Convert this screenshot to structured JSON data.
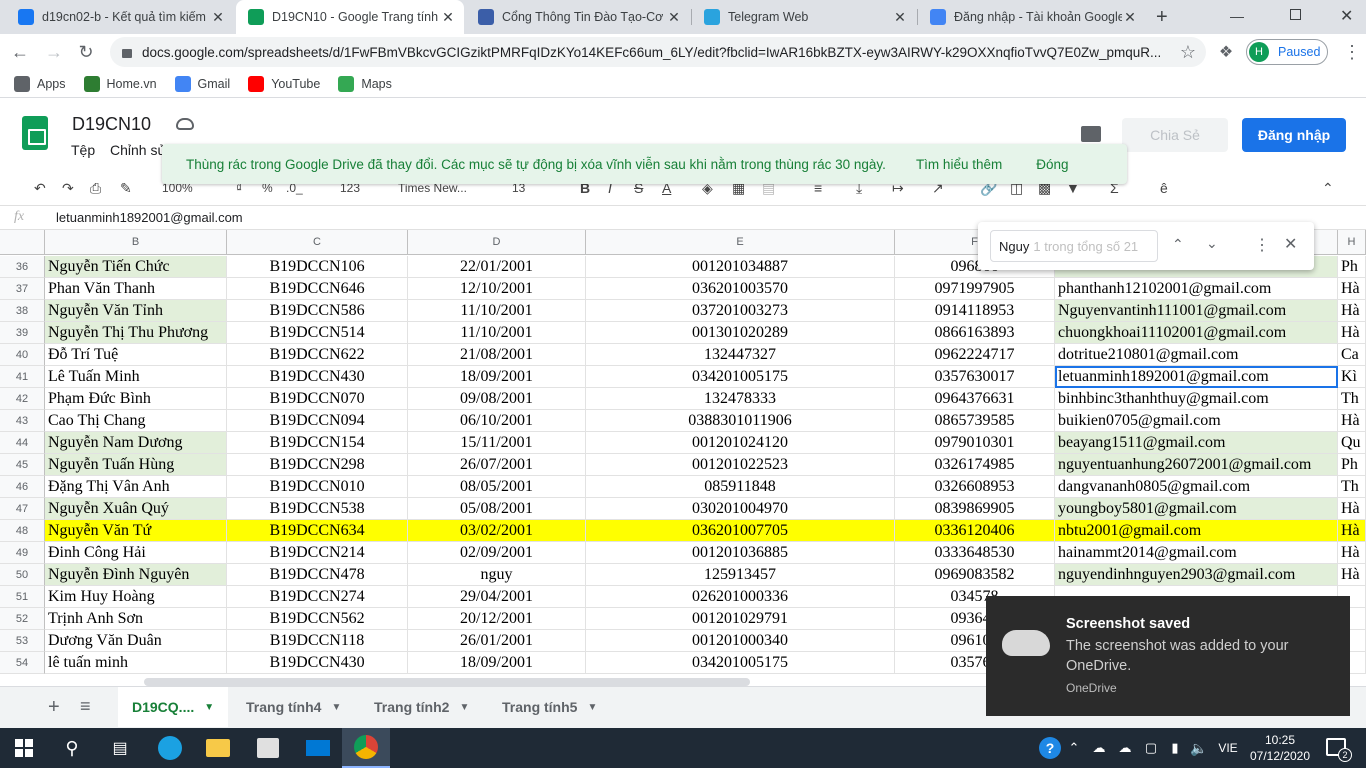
{
  "browser": {
    "tabs": [
      {
        "title": "d19cn02-b - Kết quả tìm kiếm",
        "icon": "facebook-icon",
        "color": "#1877f2"
      },
      {
        "title": "D19CN10 - Google Trang tính",
        "icon": "sheets-icon",
        "color": "#0f9d58"
      },
      {
        "title": "Cổng Thông Tin Đào Tạo-Cơ Sở",
        "icon": "portal-icon",
        "color": "#3b5ea8"
      },
      {
        "title": "Telegram Web",
        "icon": "telegram-icon",
        "color": "#2aa3de"
      },
      {
        "title": "Đăng nhập - Tài khoản Google",
        "icon": "google-icon",
        "color": "#4285f4"
      }
    ],
    "url": "docs.google.com/spreadsheets/d/1FwFBmVBkcvGCIGziktPMRFqIDzKYo14KEFc66um_6LY/edit?fbclid=IwAR16bkBZTX-eyw3AIRWY-k29OXXnqfioTvvQ7E0Zw_pmquR...",
    "profile_initial": "H",
    "profile_status": "Paused",
    "bookmarks": [
      {
        "label": "Apps",
        "icon": "apps-grid-icon"
      },
      {
        "label": "Home.vn",
        "icon": "home-vn-icon"
      },
      {
        "label": "Gmail",
        "icon": "google-icon"
      },
      {
        "label": "YouTube",
        "icon": "youtube-icon"
      },
      {
        "label": "Maps",
        "icon": "maps-icon"
      }
    ]
  },
  "sheets": {
    "doc_title": "D19CN10",
    "menu": [
      "Tệp",
      "Chỉnh sửa"
    ],
    "share_label": "Chia Sẻ",
    "login_label": "Đăng nhập",
    "toast": {
      "message": "Thùng rác trong Google Drive đã thay đổi. Các mục sẽ tự động bị xóa vĩnh viễn sau khi nằm trong thùng rác 30 ngày.",
      "learn_more": "Tìm hiểu thêm",
      "dismiss": "Đóng"
    },
    "toolbar": {
      "zoom": "100%",
      "percent": "%",
      "decimals": ".0_",
      "format_123": "123",
      "font": "Times New...",
      "font_size": "13"
    },
    "formula_bar": {
      "fx": "fx",
      "value": "letuanminh1892001@gmail.com"
    },
    "find": {
      "query": "Nguy",
      "count": "1 trong tổng số 21"
    },
    "columns": [
      "B",
      "C",
      "D",
      "E",
      "F",
      "G",
      "H"
    ],
    "rows": [
      {
        "num": "36",
        "name": "Nguyễn Tiến Chức",
        "id": "B19DCCN106",
        "dob": "22/01/2001",
        "cmnd": "001201034887",
        "phone": "096866",
        "email": "",
        "h": "Ph",
        "green": true,
        "hl": false
      },
      {
        "num": "37",
        "name": "Phan Văn Thanh",
        "id": "B19DCCN646",
        "dob": "12/10/2001",
        "cmnd": "036201003570",
        "phone": "0971997905",
        "email": "phanthanh12102001@gmail.com",
        "h": "Hà",
        "green": false,
        "hl": false
      },
      {
        "num": "38",
        "name": "Nguyễn Văn Tỉnh",
        "id": "B19DCCN586",
        "dob": "11/10/2001",
        "cmnd": "037201003273",
        "phone": "0914118953",
        "email": "Nguyenvantinh111001@gmail.com",
        "h": "Hà",
        "green": true,
        "hl": false
      },
      {
        "num": "39",
        "name": "Nguyễn Thị Thu Phương",
        "id": "B19DCCN514",
        "dob": "11/10/2001",
        "cmnd": "001301020289",
        "phone": "0866163893",
        "email": "chuongkhoai11102001@gmail.com",
        "h": "Hà",
        "green": true,
        "hl": false
      },
      {
        "num": "40",
        "name": "Đỗ Trí Tuệ",
        "id": "B19DCCN622",
        "dob": "21/08/2001",
        "cmnd": "132447327",
        "phone": "0962224717",
        "email": "dotritue210801@gmail.com",
        "h": "Ca",
        "green": false,
        "hl": false
      },
      {
        "num": "41",
        "name": "Lê Tuấn Minh",
        "id": "B19DCCN430",
        "dob": "18/09/2001",
        "cmnd": "034201005175",
        "phone": "0357630017",
        "email": "letuanminh1892001@gmail.com",
        "h": "Kì",
        "green": false,
        "hl": false
      },
      {
        "num": "42",
        "name": "Phạm Đức Bình",
        "id": "B19DCCN070",
        "dob": "09/08/2001",
        "cmnd": "132478333",
        "phone": "0964376631",
        "email": "binhbinc3thanhthuy@gmail.com",
        "h": "Th",
        "green": false,
        "hl": false
      },
      {
        "num": "43",
        "name": "Cao Thị Chang",
        "id": "B19DCCN094",
        "dob": "06/10/2001",
        "cmnd": "0388301011906",
        "phone": "0865739585",
        "email": "buikien0705@gmail.com",
        "h": "Hà",
        "green": false,
        "hl": false
      },
      {
        "num": "44",
        "name": "Nguyễn Nam Dương",
        "id": "B19DCCN154",
        "dob": "15/11/2001",
        "cmnd": "001201024120",
        "phone": "0979010301",
        "email": "beayang1511@gmail.com",
        "h": "Qu",
        "green": true,
        "hl": false
      },
      {
        "num": "45",
        "name": "Nguyễn Tuấn Hùng",
        "id": "B19DCCN298",
        "dob": "26/07/2001",
        "cmnd": "001201022523",
        "phone": "0326174985",
        "email": "nguyentuanhung26072001@gmail.com",
        "h": "Ph",
        "green": true,
        "hl": false
      },
      {
        "num": "46",
        "name": "Đặng Thị Vân Anh",
        "id": "B19DCCN010",
        "dob": "08/05/2001",
        "cmnd": "085911848",
        "phone": "0326608953",
        "email": "dangvananh0805@gmail.com",
        "h": "Th",
        "green": false,
        "hl": false
      },
      {
        "num": "47",
        "name": "Nguyễn Xuân Quý",
        "id": "B19DCCN538",
        "dob": "05/08/2001",
        "cmnd": "030201004970",
        "phone": "0839869905",
        "email": "youngboy5801@gmail.com",
        "h": "Hà",
        "green": true,
        "hl": false
      },
      {
        "num": "48",
        "name": "Nguyễn Văn Tứ",
        "id": "B19DCCN634",
        "dob": "03/02/2001",
        "cmnd": "036201007705",
        "phone": "0336120406",
        "email": "nbtu2001@gmail.com",
        "h": "Hà",
        "green": false,
        "hl": true
      },
      {
        "num": "49",
        "name": "Đinh Công Hải",
        "id": "B19DCCN214",
        "dob": "02/09/2001",
        "cmnd": "001201036885",
        "phone": "0333648530",
        "email": "hainammt2014@gmail.com",
        "h": "Hà",
        "green": false,
        "hl": false
      },
      {
        "num": "50",
        "name": "Nguyễn Đình Nguyên",
        "id": "B19DCCN478",
        "dob": "nguy",
        "cmnd": "125913457",
        "phone": "0969083582",
        "email": "nguyendinhnguyen2903@gmail.com",
        "h": "Hà",
        "green": true,
        "hl": false
      },
      {
        "num": "51",
        "name": "Kim Huy Hoàng",
        "id": "B19DCCN274",
        "dob": "29/04/2001",
        "cmnd": "026201000336",
        "phone": "034578",
        "email": "",
        "h": "",
        "green": false,
        "hl": false
      },
      {
        "num": "52",
        "name": "Trịnh Anh Sơn",
        "id": "B19DCCN562",
        "dob": "20/12/2001",
        "cmnd": "001201029791",
        "phone": "093646",
        "email": "",
        "h": "",
        "green": false,
        "hl": false
      },
      {
        "num": "53",
        "name": "Dương Văn Duân",
        "id": "B19DCCN118",
        "dob": "26/01/2001",
        "cmnd": "001201000340",
        "phone": "096100",
        "email": "",
        "h": "",
        "green": false,
        "hl": false
      },
      {
        "num": "54",
        "name": "lê tuấn minh",
        "id": "B19DCCN430",
        "dob": "18/09/2001",
        "cmnd": "034201005175",
        "phone": "035763",
        "email": "",
        "h": "",
        "green": false,
        "hl": false
      }
    ],
    "sheet_tabs": [
      "D19CQ....",
      "Trang tính4",
      "Trang tính2",
      "Trang tính5"
    ]
  },
  "onedrive_toast": {
    "title": "Screenshot saved",
    "body": "The screenshot was added to your OneDrive.",
    "source": "OneDrive"
  },
  "taskbar": {
    "lang": "VIE",
    "time": "10:25",
    "date": "07/12/2020",
    "notif_count": "2"
  }
}
